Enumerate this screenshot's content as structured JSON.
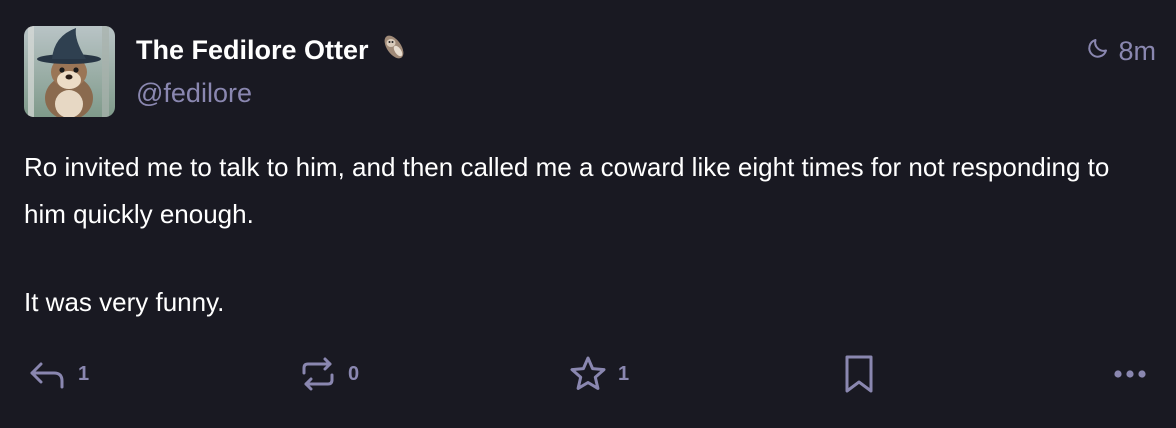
{
  "author": {
    "display_name": "The Fedilore Otter",
    "handle": "@fedilore",
    "emoji_icon": "otter-emoji"
  },
  "meta": {
    "visibility_icon": "moon-icon",
    "time_ago": "8m"
  },
  "content": {
    "paragraphs": [
      "Ro invited me to talk to him, and then called me a coward like eight times for not responding to him quickly enough.",
      "It was very funny."
    ]
  },
  "actions": {
    "reply_count": "1",
    "boost_count": "0",
    "favourite_count": "1"
  },
  "colors": {
    "background": "#191922",
    "muted": "#8a87b0",
    "text": "#ffffff"
  }
}
